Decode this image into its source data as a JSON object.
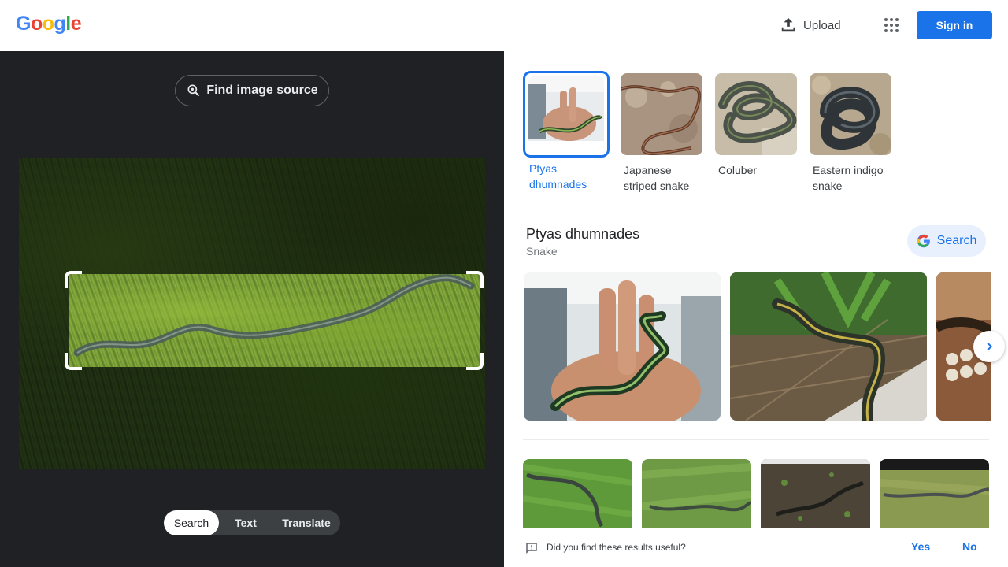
{
  "header": {
    "logo_letters": [
      "G",
      "o",
      "o",
      "g",
      "l",
      "e"
    ],
    "logo_colors": [
      "#4285f4",
      "#ea4335",
      "#fbbc05",
      "#4285f4",
      "#34a853",
      "#ea4335"
    ],
    "upload_label": "Upload",
    "signin_label": "Sign in"
  },
  "left": {
    "find_source_label": "Find image source",
    "modes": [
      "Search",
      "Text",
      "Translate"
    ],
    "active_mode": "Search"
  },
  "right": {
    "thumbnails": [
      {
        "label_line1": "Ptyas",
        "label_line2": "dhumnades",
        "selected": true
      },
      {
        "label_line1": "Japanese",
        "label_line2": "striped snake",
        "selected": false
      },
      {
        "label_line1": "Coluber",
        "label_line2": "",
        "selected": false
      },
      {
        "label_line1": "Eastern indigo",
        "label_line2": "snake",
        "selected": false
      }
    ],
    "entity": {
      "title": "Ptyas dhumnades",
      "subtitle": "Snake",
      "search_label": "Search"
    },
    "feedback": {
      "question": "Did you find these results useful?",
      "yes": "Yes",
      "no": "No"
    }
  },
  "colors": {
    "accent": "#1a73e8",
    "dark_bg": "#202124"
  }
}
